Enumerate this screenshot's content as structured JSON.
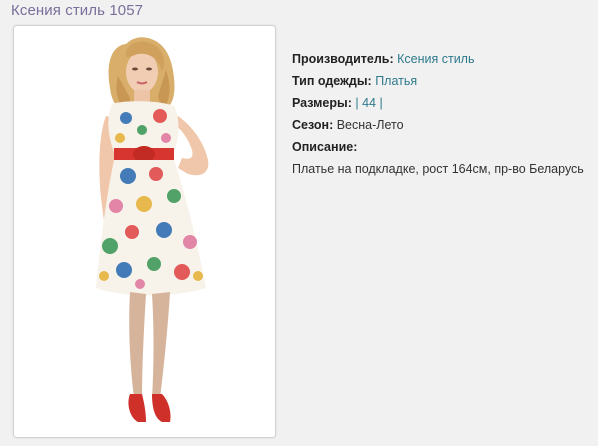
{
  "product": {
    "title": "Ксения стиль 1057"
  },
  "photo": {
    "alt": "model-in-floral-dress"
  },
  "specs": {
    "manufacturer_label": "Производитель:",
    "manufacturer_value": "Ксения стиль",
    "clothing_type_label": "Тип одежды:",
    "clothing_type_value": "Платья",
    "sizes_label": "Размеры:",
    "sizes_sep_left": "|",
    "sizes_value": "44",
    "sizes_sep_right": "|",
    "season_label": "Сезон:",
    "season_value": "Весна-Лето",
    "description_label": "Описание:",
    "description_value": "Платье на подкладке, рост 164см, пр-во Беларусь"
  },
  "colors": {
    "title": "#7a6f9b",
    "link": "#2d7a8c",
    "text": "#333333",
    "background": "#f1f1f1"
  }
}
